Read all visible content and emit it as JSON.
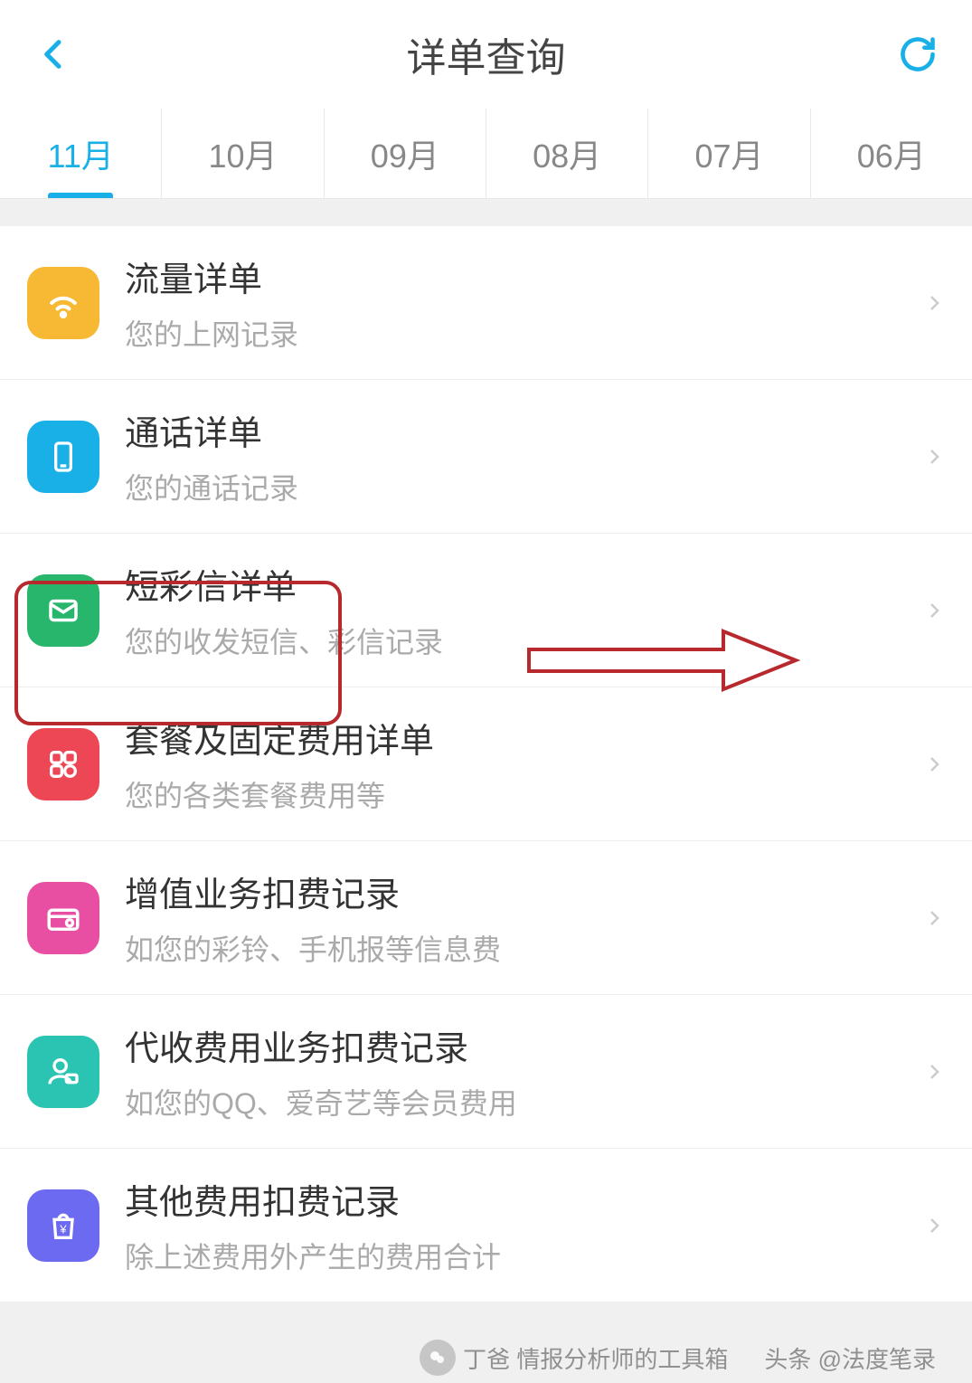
{
  "header": {
    "title": "详单查询"
  },
  "tabs": [
    {
      "label": "11月",
      "active": true
    },
    {
      "label": "10月",
      "active": false
    },
    {
      "label": "09月",
      "active": false
    },
    {
      "label": "08月",
      "active": false
    },
    {
      "label": "07月",
      "active": false
    },
    {
      "label": "06月",
      "active": false
    }
  ],
  "items": [
    {
      "title": "流量详单",
      "sub": "您的上网记录",
      "icon": "wifi",
      "color": "#f7b934"
    },
    {
      "title": "通话详单",
      "sub": "您的通话记录",
      "icon": "phone",
      "color": "#19b0e7"
    },
    {
      "title": "短彩信详单",
      "sub": "您的收发短信、彩信记录",
      "icon": "mail",
      "color": "#27b66b"
    },
    {
      "title": "套餐及固定费用详单",
      "sub": "您的各类套餐费用等",
      "icon": "grid",
      "color": "#ed4756"
    },
    {
      "title": "增值业务扣费记录",
      "sub": "如您的彩铃、手机报等信息费",
      "icon": "card",
      "color": "#e84fa3"
    },
    {
      "title": "代收费用业务扣费记录",
      "sub": "如您的QQ、爱奇艺等会员费用",
      "icon": "user",
      "color": "#2bc4b3"
    },
    {
      "title": "其他费用扣费记录",
      "sub": "除上述费用外产生的费用合计",
      "icon": "bag",
      "color": "#6b6af0"
    }
  ],
  "watermarks": [
    "丁爸 情报分析师的工具箱",
    "头条 @法度笔录"
  ],
  "colors": {
    "accent": "#19b0e7",
    "highlight": "#b8292e"
  }
}
